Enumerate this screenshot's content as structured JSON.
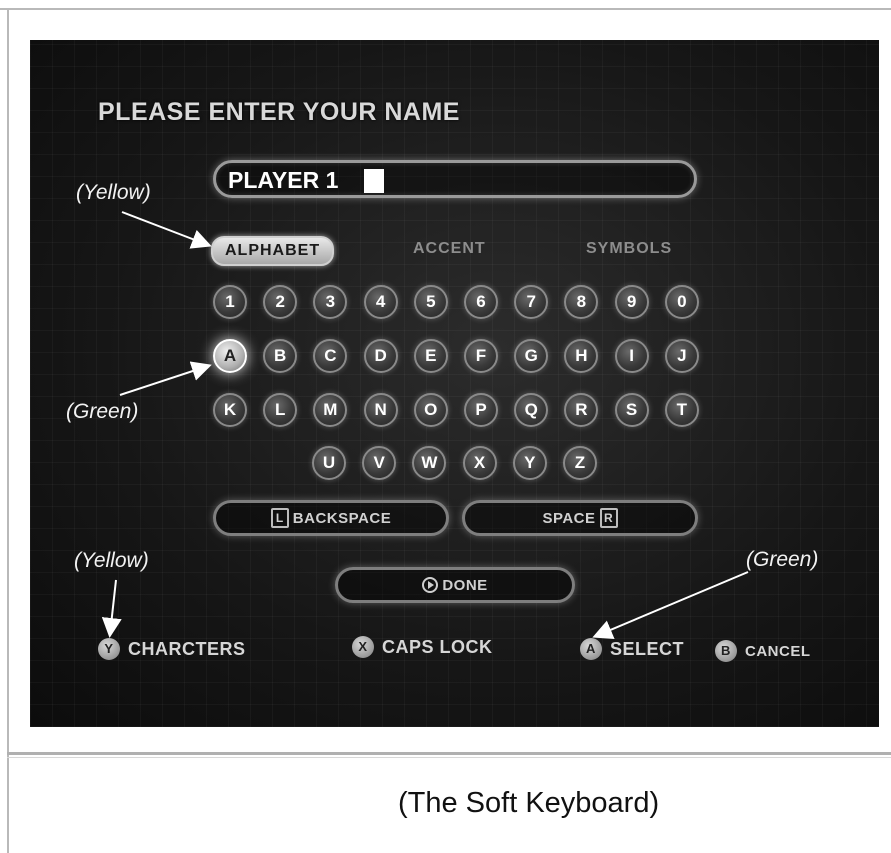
{
  "screen": {
    "prompt": "PLEASE ENTER YOUR NAME",
    "name_value": "PLAYER 1",
    "tabs": [
      {
        "label": "ALPHABET",
        "state": "active"
      },
      {
        "label": "ACCENT",
        "state": "inactive"
      },
      {
        "label": "SYMBOLS",
        "state": "inactive"
      }
    ],
    "keyboard_rows": [
      [
        "1",
        "2",
        "3",
        "4",
        "5",
        "6",
        "7",
        "8",
        "9",
        "0"
      ],
      [
        "A",
        "B",
        "C",
        "D",
        "E",
        "F",
        "G",
        "H",
        "I",
        "J"
      ],
      [
        "K",
        "L",
        "M",
        "N",
        "O",
        "P",
        "Q",
        "R",
        "S",
        "T"
      ],
      [
        "U",
        "V",
        "W",
        "X",
        "Y",
        "Z"
      ]
    ],
    "selected_key": "A",
    "backspace": {
      "shoulder": "L",
      "label": "BACKSPACE"
    },
    "space": {
      "label": "SPACE",
      "shoulder": "R"
    },
    "done": {
      "label": "DONE",
      "icon": "play-icon"
    },
    "hints": {
      "characters": {
        "button": "Y",
        "label": "CHARCTERS"
      },
      "caps_lock": {
        "button": "X",
        "label": "CAPS LOCK"
      },
      "select": {
        "button": "A",
        "label": "SELECT"
      },
      "cancel": {
        "button": "B",
        "label": "CANCEL"
      }
    }
  },
  "annotations": {
    "yellow_tab": "(Yellow)",
    "green_key": "(Green)",
    "yellow_hint": "(Yellow)",
    "green_hint": "(Green)"
  },
  "caption": "(The Soft Keyboard)",
  "colors": {
    "screen_bg": "#161616",
    "text_light": "#d9d9d9",
    "highlight": "#e8e8e8"
  }
}
